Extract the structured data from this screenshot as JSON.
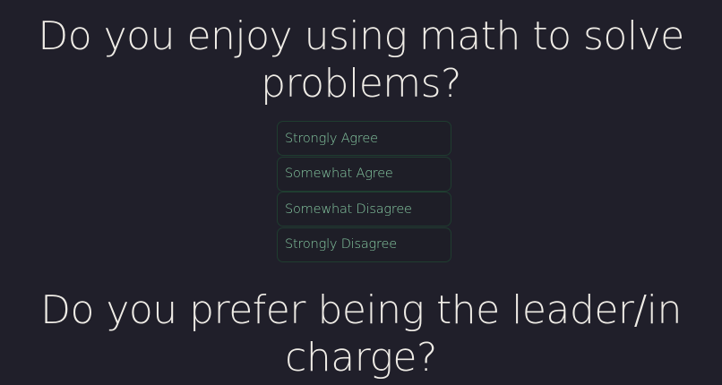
{
  "questions": [
    {
      "text": "Do you enjoy using math to solve problems?",
      "options": [
        "Strongly Agree",
        "Somewhat Agree",
        "Somewhat Disagree",
        "Strongly Disagree"
      ]
    },
    {
      "text": "Do you prefer being the leader/in charge?"
    }
  ],
  "colors": {
    "background": "#201f2a",
    "question_text": "#efece6",
    "option_text": "#86c9a2",
    "option_border": "#1f3d30"
  }
}
